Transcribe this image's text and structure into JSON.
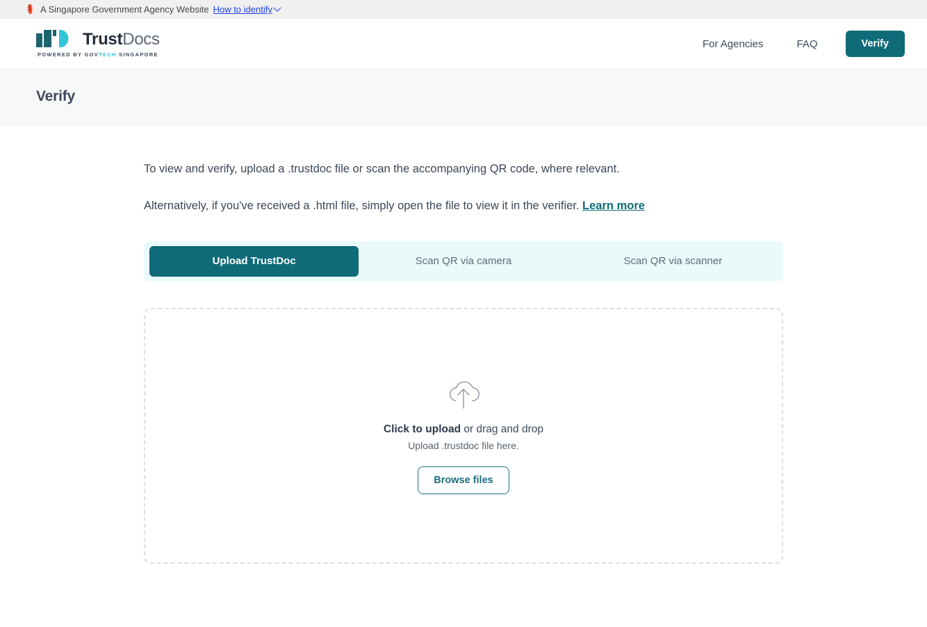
{
  "masthead": {
    "icon": "singapore-lion-icon",
    "text": "A Singapore Government Agency Website",
    "link_label": "How to identify",
    "chevron": "chevron-down-icon",
    "link_color": "#1f3df0",
    "background": "#f0f0f0"
  },
  "header": {
    "logo": {
      "mark": "trustdocs-logo-mark",
      "word_bold": "Trust",
      "word_light": "Docs",
      "tagline_prefix": "POWERED BY GOV",
      "tagline_accent": "TECH",
      "tagline_suffix": " SINGAPORE",
      "dark_teal": "#1d6470",
      "cyan": "#2fbfd0"
    },
    "nav": [
      {
        "label": "For Agencies"
      },
      {
        "label": "FAQ"
      }
    ],
    "cta": {
      "label": "Verify",
      "background": "#0f6b78",
      "color": "#ffffff"
    }
  },
  "page": {
    "title": "Verify",
    "title_band_background": "#f7f8fa"
  },
  "intro": {
    "line1": "To view and verify, upload a .trustdoc file or scan the accompanying QR code, where relevant.",
    "line2_prefix": "Alternatively, if you've received a .html file, simply open the file to view it in the verifier.",
    "learn_more": "Learn more"
  },
  "tabs": {
    "background": "#eafafa",
    "active_background": "#0f6b78",
    "items": [
      {
        "label": "Upload TrustDoc",
        "active": true
      },
      {
        "label": "Scan QR via camera",
        "active": false
      },
      {
        "label": "Scan QR via scanner",
        "active": false
      }
    ]
  },
  "dropzone": {
    "icon": "cloud-upload-icon",
    "click_label": "Click to upload",
    "drag_label": " or drag and drop",
    "hint": "Upload .trustdoc file here.",
    "browse_label": "Browse files",
    "border_color": "#dcdfe6",
    "accent": "#1d6f7c"
  }
}
